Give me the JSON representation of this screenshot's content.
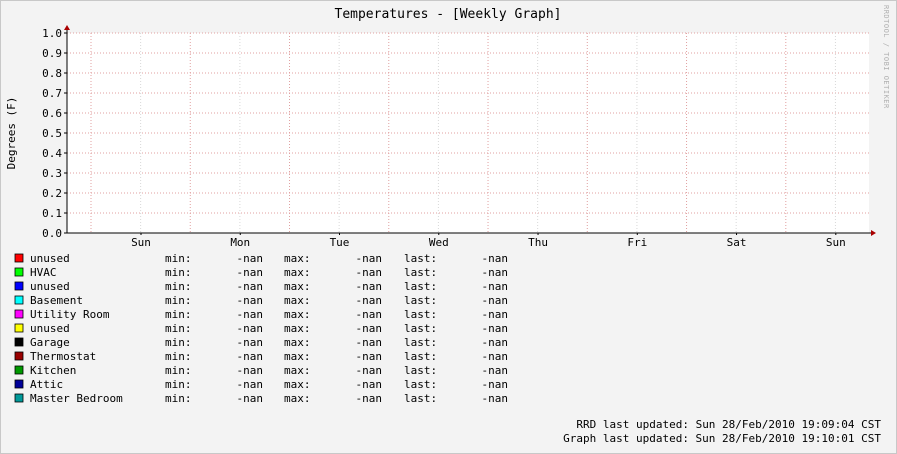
{
  "chart_data": {
    "type": "line",
    "title": "Temperatures - [Weekly Graph]",
    "ylabel": "Degrees (F)",
    "xlabel": "",
    "ylim": [
      0.0,
      1.0
    ],
    "y_ticks": [
      "1.0",
      "0.9",
      "0.8",
      "0.7",
      "0.6",
      "0.5",
      "0.4",
      "0.3",
      "0.2",
      "0.1",
      "0.0"
    ],
    "x_ticks": [
      "Sun",
      "Mon",
      "Tue",
      "Wed",
      "Thu",
      "Fri",
      "Sat",
      "Sun"
    ],
    "grid": true,
    "legend_placement": "bottom",
    "series": [
      {
        "name": "unused",
        "color": "#ff0000",
        "min": "-nan",
        "max": "-nan",
        "last": "-nan",
        "values": []
      },
      {
        "name": "HVAC",
        "color": "#00ff00",
        "min": "-nan",
        "max": "-nan",
        "last": "-nan",
        "values": []
      },
      {
        "name": "unused",
        "color": "#0000ff",
        "min": "-nan",
        "max": "-nan",
        "last": "-nan",
        "values": []
      },
      {
        "name": "Basement",
        "color": "#00ffff",
        "min": "-nan",
        "max": "-nan",
        "last": "-nan",
        "values": []
      },
      {
        "name": "Utility Room",
        "color": "#ff00ff",
        "min": "-nan",
        "max": "-nan",
        "last": "-nan",
        "values": []
      },
      {
        "name": "unused",
        "color": "#ffff00",
        "min": "-nan",
        "max": "-nan",
        "last": "-nan",
        "values": []
      },
      {
        "name": "Garage",
        "color": "#000000",
        "min": "-nan",
        "max": "-nan",
        "last": "-nan",
        "values": []
      },
      {
        "name": "Thermostat",
        "color": "#990000",
        "min": "-nan",
        "max": "-nan",
        "last": "-nan",
        "values": []
      },
      {
        "name": "Kitchen",
        "color": "#009900",
        "min": "-nan",
        "max": "-nan",
        "last": "-nan",
        "values": []
      },
      {
        "name": "Attic",
        "color": "#000099",
        "min": "-nan",
        "max": "-nan",
        "last": "-nan",
        "values": []
      },
      {
        "name": "Master Bedroom",
        "color": "#009999",
        "min": "-nan",
        "max": "-nan",
        "last": "-nan",
        "values": []
      }
    ]
  },
  "legend_labels": {
    "min": "min:",
    "max": "max:",
    "last": "last:"
  },
  "watermark": "RRDTOOL / TOBI OETIKER",
  "footer": {
    "rrd_updated": "RRD last updated: Sun 28/Feb/2010 19:09:04 CST",
    "graph_updated": "Graph last updated: Sun 28/Feb/2010 19:10:01 CST"
  },
  "colors": {
    "background": "#f3f3f3",
    "plot_area": "#ffffff",
    "grid_major": "#e0a0a0",
    "grid_minor": "#d8d8d8",
    "axis": "#000000",
    "arrow": "#aa0000"
  }
}
